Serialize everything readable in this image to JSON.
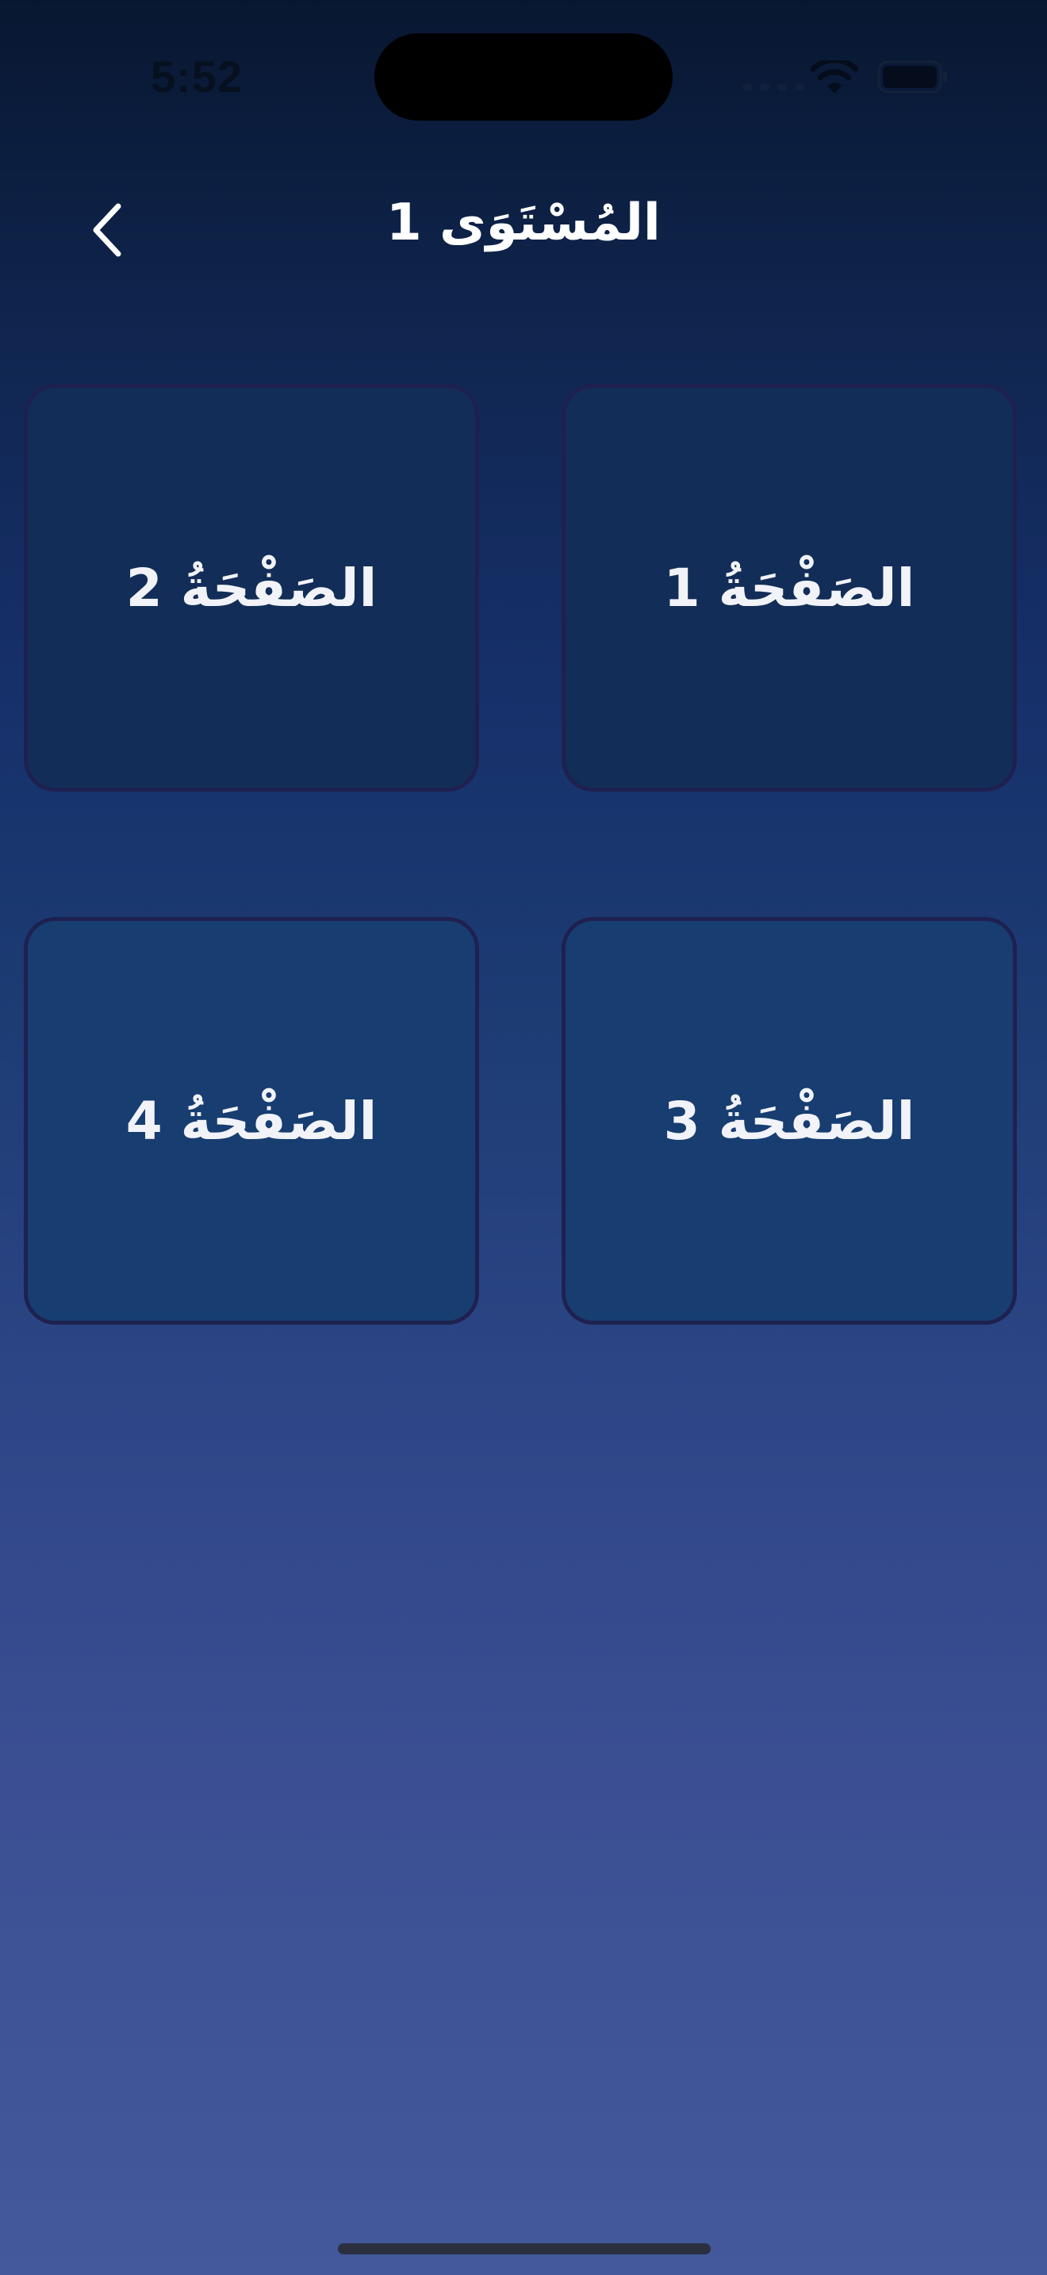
{
  "status_bar": {
    "time": "5:52",
    "wifi_icon": "wifi-icon",
    "battery_icon": "battery-icon"
  },
  "header": {
    "back_icon": "chevron-left-icon",
    "title": "المُسْتَوَى 1"
  },
  "pages": [
    {
      "label": "الصَفْحَةُ 1"
    },
    {
      "label": "الصَفْحَةُ 2"
    },
    {
      "label": "الصَفْحَةُ 3"
    },
    {
      "label": "الصَفْحَةُ 4"
    }
  ],
  "colors": {
    "card_border": "#1e2150",
    "card_top_row": "#122d57",
    "card_bottom_row": "#173d71",
    "text": "#ffffff"
  }
}
